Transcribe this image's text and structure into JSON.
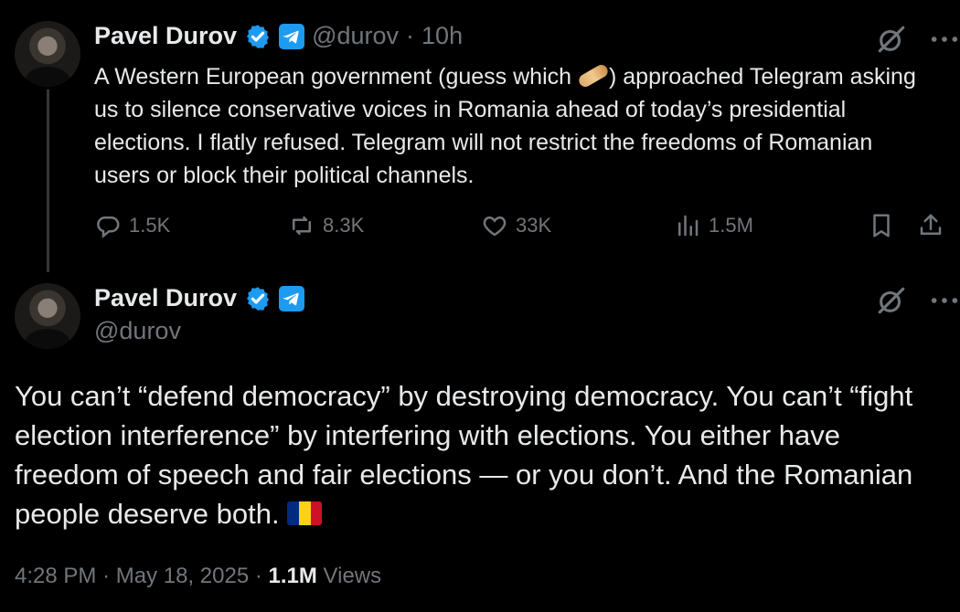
{
  "tweet1": {
    "author_name": "Pavel Durov",
    "handle": "@durov",
    "separator": "·",
    "time": "10h",
    "text_before": "A Western European government (guess which ",
    "text_after": ") approached Telegram asking us to silence conservative voices in Romania ahead of today’s presidential elections. I flatly refused. Telegram will not restrict the freedoms of Romanian users or block their political channels.",
    "stats": {
      "replies": "1.5K",
      "reposts": "8.3K",
      "likes": "33K",
      "views": "1.5M"
    }
  },
  "tweet2": {
    "author_name": "Pavel Durov",
    "handle": "@durov",
    "text": "You can’t “defend democracy” by destroying democracy. You can’t “fight election interference” by interfering with elections. You either have freedom of speech and fair elections — or you don’t. And the Romanian people deserve both.",
    "meta_time": "4:28 PM",
    "meta_date": "May 18, 2025",
    "meta_sep": "·",
    "views_count": "1.1M",
    "views_label": "Views"
  },
  "icons": {
    "verified": "verified-badge-icon",
    "telegram": "telegram-icon",
    "grok": "grok-icon",
    "more": "more-icon",
    "reply": "reply-icon",
    "repost": "repost-icon",
    "like": "heart-icon",
    "views": "views-icon",
    "bookmark": "bookmark-icon",
    "share": "share-icon"
  },
  "colors": {
    "background": "#000000",
    "primary_text": "#e7e9ea",
    "secondary_text": "#71767b",
    "verified_blue": "#1d9bf0",
    "flag_blue": "#002b7f",
    "flag_yellow": "#fcd116",
    "flag_red": "#ce1126"
  }
}
